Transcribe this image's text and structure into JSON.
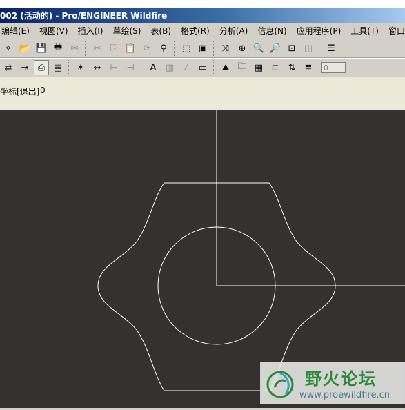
{
  "window": {
    "title": "002 (活动的) - Pro/ENGINEER Wildfire"
  },
  "menu": [
    "编辑(E)",
    "视图(V)",
    "插入(I)",
    "草绘(S)",
    "表(B)",
    "格式(R)",
    "分析(A)",
    "信息(N)",
    "应用程序(P)",
    "工具(T)",
    "窗口(W)"
  ],
  "toolbar1": [
    {
      "name": "new-icon",
      "glyph": "✧",
      "enabled": true
    },
    {
      "name": "open-icon",
      "glyph": "📂",
      "enabled": true
    },
    {
      "name": "save-icon",
      "glyph": "💾",
      "enabled": true
    },
    {
      "name": "print-icon",
      "glyph": "🖶",
      "enabled": true
    },
    {
      "name": "email-icon",
      "glyph": "✉",
      "enabled": false
    },
    {
      "name": "cut-icon",
      "glyph": "✂",
      "enabled": false
    },
    {
      "name": "copy-icon",
      "glyph": "⎘",
      "enabled": false
    },
    {
      "name": "paste-icon",
      "glyph": "📋",
      "enabled": false
    },
    {
      "name": "regenerate-icon",
      "glyph": "⟳",
      "enabled": false
    },
    {
      "name": "find-icon",
      "glyph": "⚲",
      "enabled": true
    },
    {
      "name": "select-box-icon",
      "glyph": "⬚",
      "enabled": true
    },
    {
      "name": "repaint-icon",
      "glyph": "▣",
      "enabled": true
    },
    {
      "name": "spin-center-icon",
      "glyph": "⤨",
      "enabled": true
    },
    {
      "name": "orient-icon",
      "glyph": "⊕",
      "enabled": true
    },
    {
      "name": "zoom-in-icon",
      "glyph": "🔍",
      "enabled": true
    },
    {
      "name": "zoom-out-icon",
      "glyph": "🔎",
      "enabled": true
    },
    {
      "name": "refit-icon",
      "glyph": "⊡",
      "enabled": true
    },
    {
      "name": "saved-views-icon",
      "glyph": "◫",
      "enabled": false
    },
    {
      "name": "layers-icon",
      "glyph": "☰",
      "enabled": true
    }
  ],
  "toolbar2": [
    {
      "name": "sheet-icon",
      "glyph": "⇄",
      "enabled": true
    },
    {
      "name": "move-item-icon",
      "glyph": "⇥",
      "enabled": true
    },
    {
      "name": "note-icon",
      "glyph": "⎙",
      "enabled": true,
      "pressed": true
    },
    {
      "name": "table-insert-icon",
      "glyph": "▤",
      "enabled": true
    },
    {
      "name": "show-annotation-icon",
      "glyph": "✶",
      "enabled": true
    },
    {
      "name": "dimension-icon",
      "glyph": "↔",
      "enabled": true
    },
    {
      "name": "ordinate-dim-icon",
      "glyph": "⊢",
      "enabled": false
    },
    {
      "name": "ref-dim-icon",
      "glyph": "⊣",
      "enabled": false
    },
    {
      "name": "text-style-icon",
      "glyph": "A",
      "enabled": true
    },
    {
      "name": "hatch-icon",
      "glyph": "▥",
      "enabled": false
    },
    {
      "name": "line-style-icon",
      "glyph": "⁄",
      "enabled": false
    },
    {
      "name": "scale-icon",
      "glyph": "▭",
      "enabled": true
    },
    {
      "name": "symbol-icon",
      "glyph": "⛰",
      "enabled": true
    },
    {
      "name": "folder-icon",
      "glyph": "🗀",
      "enabled": true
    },
    {
      "name": "table-icon",
      "glyph": "▦",
      "enabled": true
    },
    {
      "name": "snap-icon",
      "glyph": "⊏",
      "enabled": true
    },
    {
      "name": "update-icon",
      "glyph": "⇅",
      "enabled": true
    },
    {
      "name": "list-icon",
      "glyph": "≣",
      "enabled": true
    }
  ],
  "toolbar2_value": "0",
  "message": {
    "prompt": "坐标[退出]",
    "value": "0"
  },
  "watermark": {
    "title": "野火论坛",
    "url": "www.proewildfire.cn"
  },
  "colors": {
    "canvas": "#33322f",
    "geometry": "#ffffff",
    "titlebar": "#0a246a",
    "watermark_green": "#2e8a3a"
  }
}
